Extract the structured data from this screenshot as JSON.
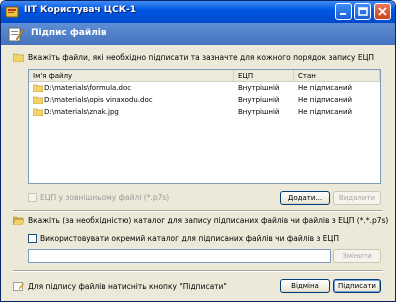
{
  "window": {
    "title": "ІІТ Користувач ЦСК-1"
  },
  "header": {
    "title": "Підпис файлів"
  },
  "files_section": {
    "instruction": "Вкажіть файли, які необхідно підписати та зазначте для кожного порядок запису ЕЦП"
  },
  "table": {
    "columns": [
      "Ім'я файлу",
      "ЕЦП",
      "Стан"
    ],
    "rows": [
      {
        "name": "D:\\materials\\formula.doc",
        "signature": "Внутрішній",
        "status": "Не підписаний"
      },
      {
        "name": "D:\\materials\\opis vinaxodu.doc",
        "signature": "Внутрішній",
        "status": "Не підписаний"
      },
      {
        "name": "D:\\materials\\znak.jpg",
        "signature": "Внутрішній",
        "status": "Не підписаний"
      }
    ]
  },
  "options": {
    "external_file_label": "ЕЦП у зовнішньому файлі (*.p7s)",
    "add_button": "Додати...",
    "remove_button": "Видалити"
  },
  "catalog_section": {
    "instruction": "Вкажіть (за необхідністю) каталог для запису підписаних файлів чи файлів з ЕЦП (*.*.p7s)",
    "use_separate_label": "Використовувати окремий каталог для підписаних файлів чи файлів з ЕЦП",
    "change_button": "Змінити"
  },
  "footer": {
    "hint": "Для підпису файлів натисніть кнопку \"Підписати\"",
    "cancel_button": "Відміна",
    "sign_button": "Підписати"
  }
}
